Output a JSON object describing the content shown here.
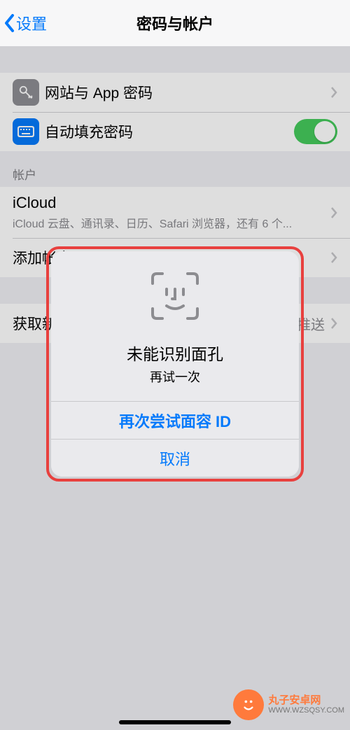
{
  "nav": {
    "back_label": "设置",
    "title": "密码与帐户"
  },
  "passwords_group": {
    "websites_label": "网站与 App 密码",
    "autofill_label": "自动填充密码",
    "autofill_on": true
  },
  "accounts_section": {
    "header": "帐户",
    "icloud": {
      "title": "iCloud",
      "detail": "iCloud 云盘、通讯录、日历、Safari 浏览器，还有 6 个..."
    },
    "add_label": "添加帐户"
  },
  "fetch_row": {
    "label": "获取新数据",
    "value": "推送"
  },
  "dialog": {
    "title": "未能识别面孔",
    "subtitle": "再试一次",
    "retry": "再次尝试面容 ID",
    "cancel": "取消"
  },
  "watermark": {
    "line1": "丸子安卓网",
    "line2": "WWW.WZSQSY.COM"
  }
}
